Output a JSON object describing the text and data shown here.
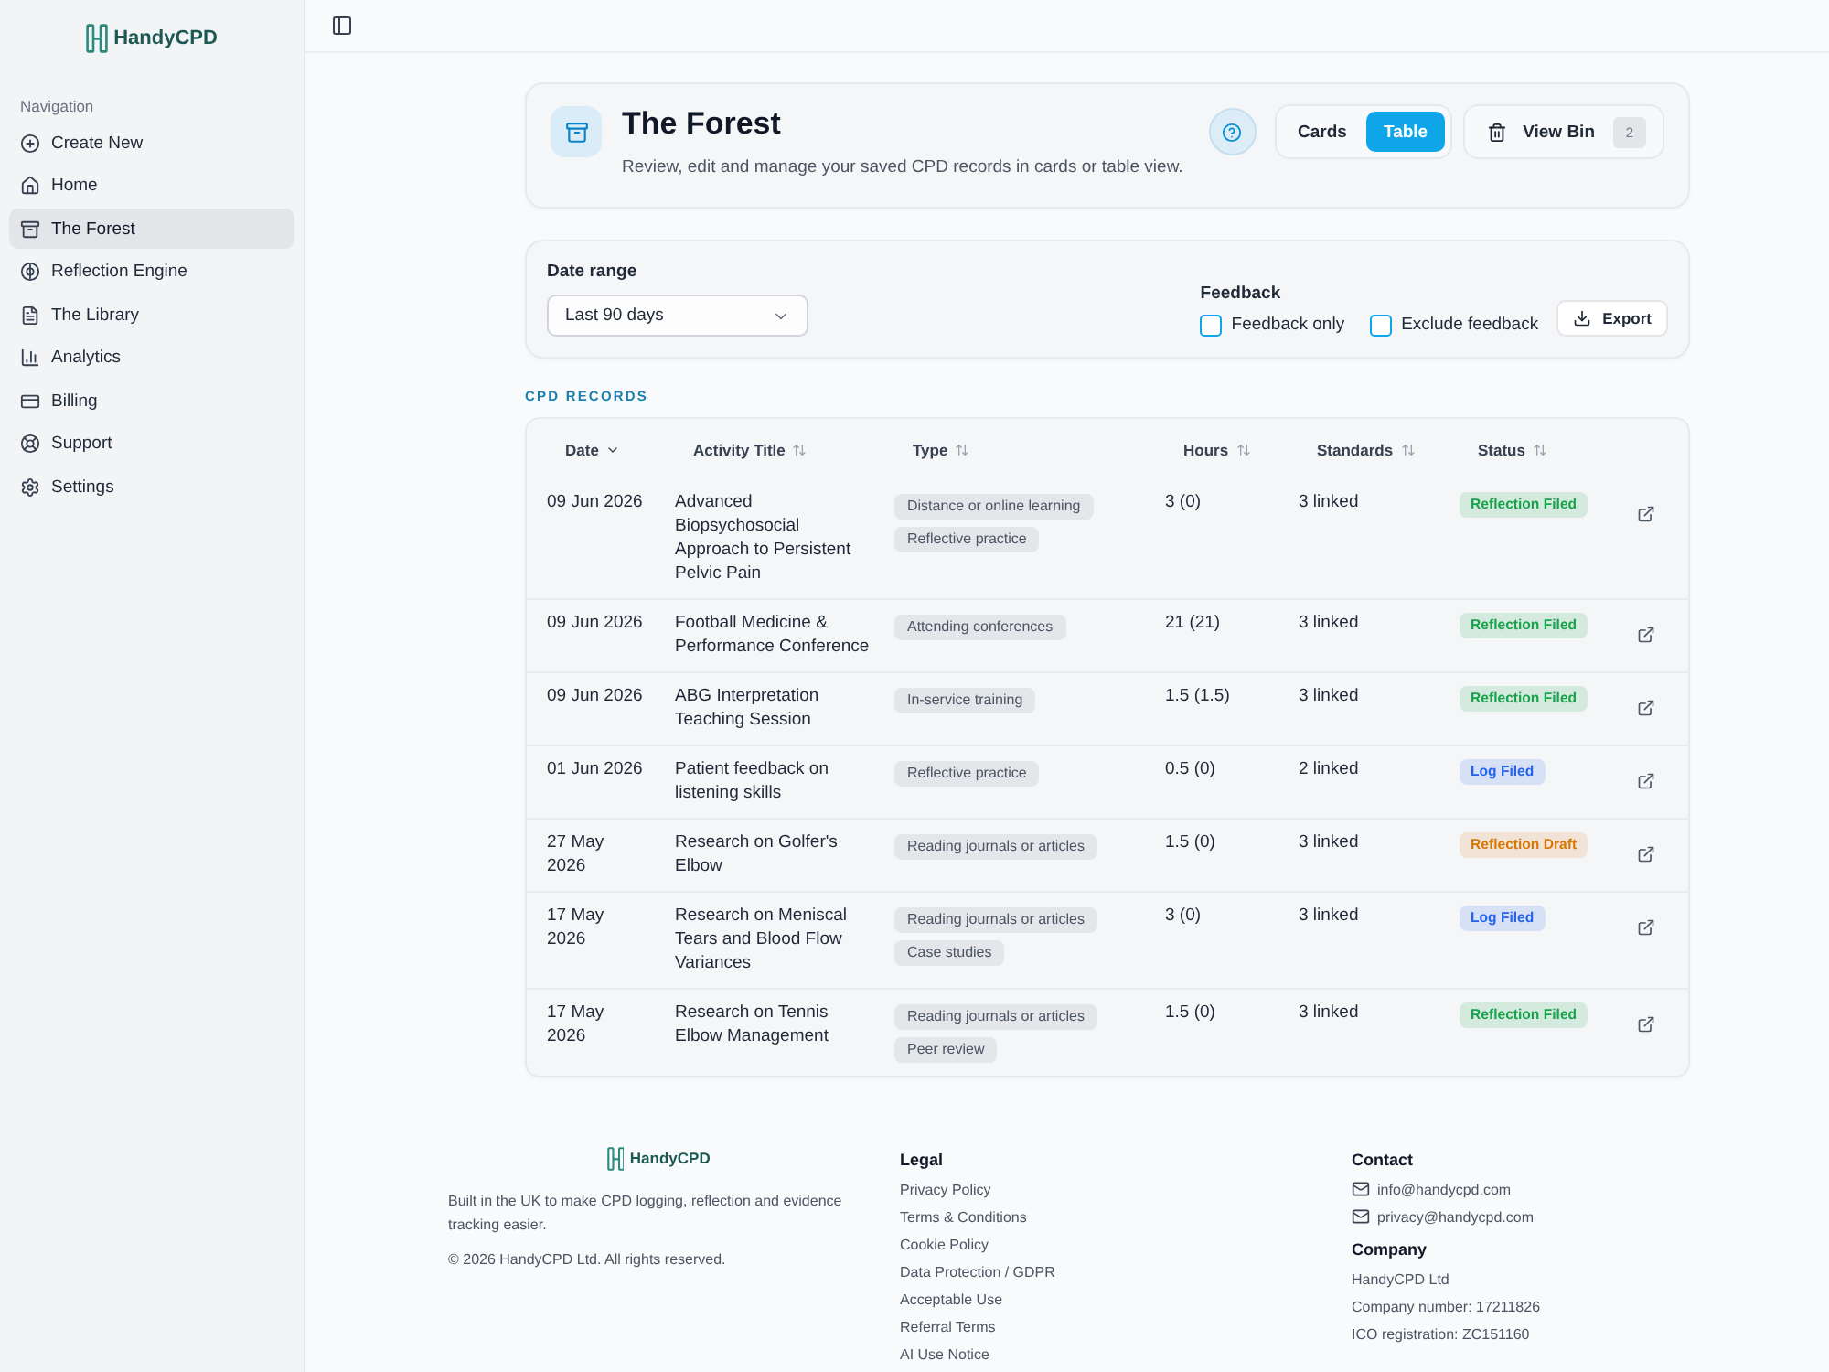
{
  "sidebar": {
    "brand": "HandyCPD",
    "section_label": "Navigation",
    "items": [
      {
        "label": "Create New",
        "selected": false
      },
      {
        "label": "Home",
        "selected": false
      },
      {
        "label": "The Forest",
        "selected": true
      },
      {
        "label": "Reflection Engine",
        "selected": false
      },
      {
        "label": "The Library",
        "selected": false
      },
      {
        "label": "Analytics",
        "selected": false
      },
      {
        "label": "Billing",
        "selected": false
      },
      {
        "label": "Support",
        "selected": false
      },
      {
        "label": "Settings",
        "selected": false
      }
    ]
  },
  "header": {
    "title": "The Forest",
    "subtitle": "Review, edit and manage your saved CPD records in cards or table view.",
    "view_toggle": [
      {
        "label": "Cards",
        "selected": false
      },
      {
        "label": "Table",
        "selected": true
      }
    ],
    "bin": {
      "label": "View Bin",
      "count": "2"
    }
  },
  "filters": {
    "date_range": {
      "label": "Date range",
      "value": "Last 90 days"
    },
    "feedback": {
      "label": "Feedback",
      "options": [
        {
          "label": "Feedback only",
          "checked": false
        },
        {
          "label": "Exclude feedback",
          "checked": false
        }
      ]
    },
    "export": "Export"
  },
  "table": {
    "section_title": "CPD RECORDS",
    "columns": [
      {
        "label": "Date",
        "sorted": true
      },
      {
        "label": "Activity Title",
        "sorted": false
      },
      {
        "label": "Type",
        "sorted": false
      },
      {
        "label": "Hours",
        "sorted": false
      },
      {
        "label": "Standards",
        "sorted": false
      },
      {
        "label": "Status",
        "sorted": false
      }
    ],
    "rows": [
      {
        "date": "09 Jun 2026",
        "title": "Advanced Biopsychosocial Approach to Persistent Pelvic Pain",
        "types": [
          "Distance or online learning",
          "Reflective practice"
        ],
        "hours": "3 (0)",
        "standards": "3 linked",
        "status": {
          "label": "Reflection Filed",
          "color": "#16a34a"
        }
      },
      {
        "date": "09 Jun 2026",
        "title": "Football Medicine & Performance Conference",
        "types": [
          "Attending conferences"
        ],
        "hours": "21 (21)",
        "standards": "3 linked",
        "status": {
          "label": "Reflection Filed",
          "color": "#16a34a"
        }
      },
      {
        "date": "09 Jun 2026",
        "title": "ABG Interpretation Teaching Session",
        "types": [
          "In-service training"
        ],
        "hours": "1.5 (1.5)",
        "standards": "3 linked",
        "status": {
          "label": "Reflection Filed",
          "color": "#16a34a"
        }
      },
      {
        "date": "01 Jun 2026",
        "title": "Patient feedback on listening skills",
        "types": [
          "Reflective practice"
        ],
        "hours": "0.5 (0)",
        "standards": "2 linked",
        "status": {
          "label": "Log Filed",
          "color": "#2563eb"
        }
      },
      {
        "date": "27 May 2026",
        "title": "Research on Golfer's Elbow",
        "types": [
          "Reading journals or articles"
        ],
        "hours": "1.5 (0)",
        "standards": "3 linked",
        "status": {
          "label": "Reflection Draft",
          "color": "#d97706"
        }
      },
      {
        "date": "17 May 2026",
        "title": "Research on Meniscal Tears and Blood Flow Variances",
        "types": [
          "Reading journals or articles",
          "Case studies"
        ],
        "hours": "3 (0)",
        "standards": "3 linked",
        "status": {
          "label": "Log Filed",
          "color": "#2563eb"
        }
      },
      {
        "date": "17 May 2026",
        "title": "Research on Tennis Elbow Management",
        "types": [
          "Reading journals or articles",
          "Peer review"
        ],
        "hours": "1.5 (0)",
        "standards": "3 linked",
        "status": {
          "label": "Reflection Filed",
          "color": "#16a34a"
        }
      }
    ]
  },
  "footer": {
    "brand": "HandyCPD",
    "tagline": "Built in the UK to make CPD logging, reflection and evidence tracking easier.",
    "copyright": "© 2026 HandyCPD Ltd. All rights reserved.",
    "legal": {
      "title": "Legal",
      "links": [
        "Privacy Policy",
        "Terms & Conditions",
        "Cookie Policy",
        "Data Protection / GDPR",
        "Acceptable Use",
        "Referral Terms",
        "AI Use Notice"
      ]
    },
    "contact": {
      "title": "Contact",
      "emails": [
        "info@handycpd.com",
        "privacy@handycpd.com"
      ]
    },
    "company": {
      "title": "Company",
      "lines": [
        "HandyCPD Ltd",
        "Company number: 17211826",
        "ICO registration: ZC151160"
      ]
    }
  }
}
